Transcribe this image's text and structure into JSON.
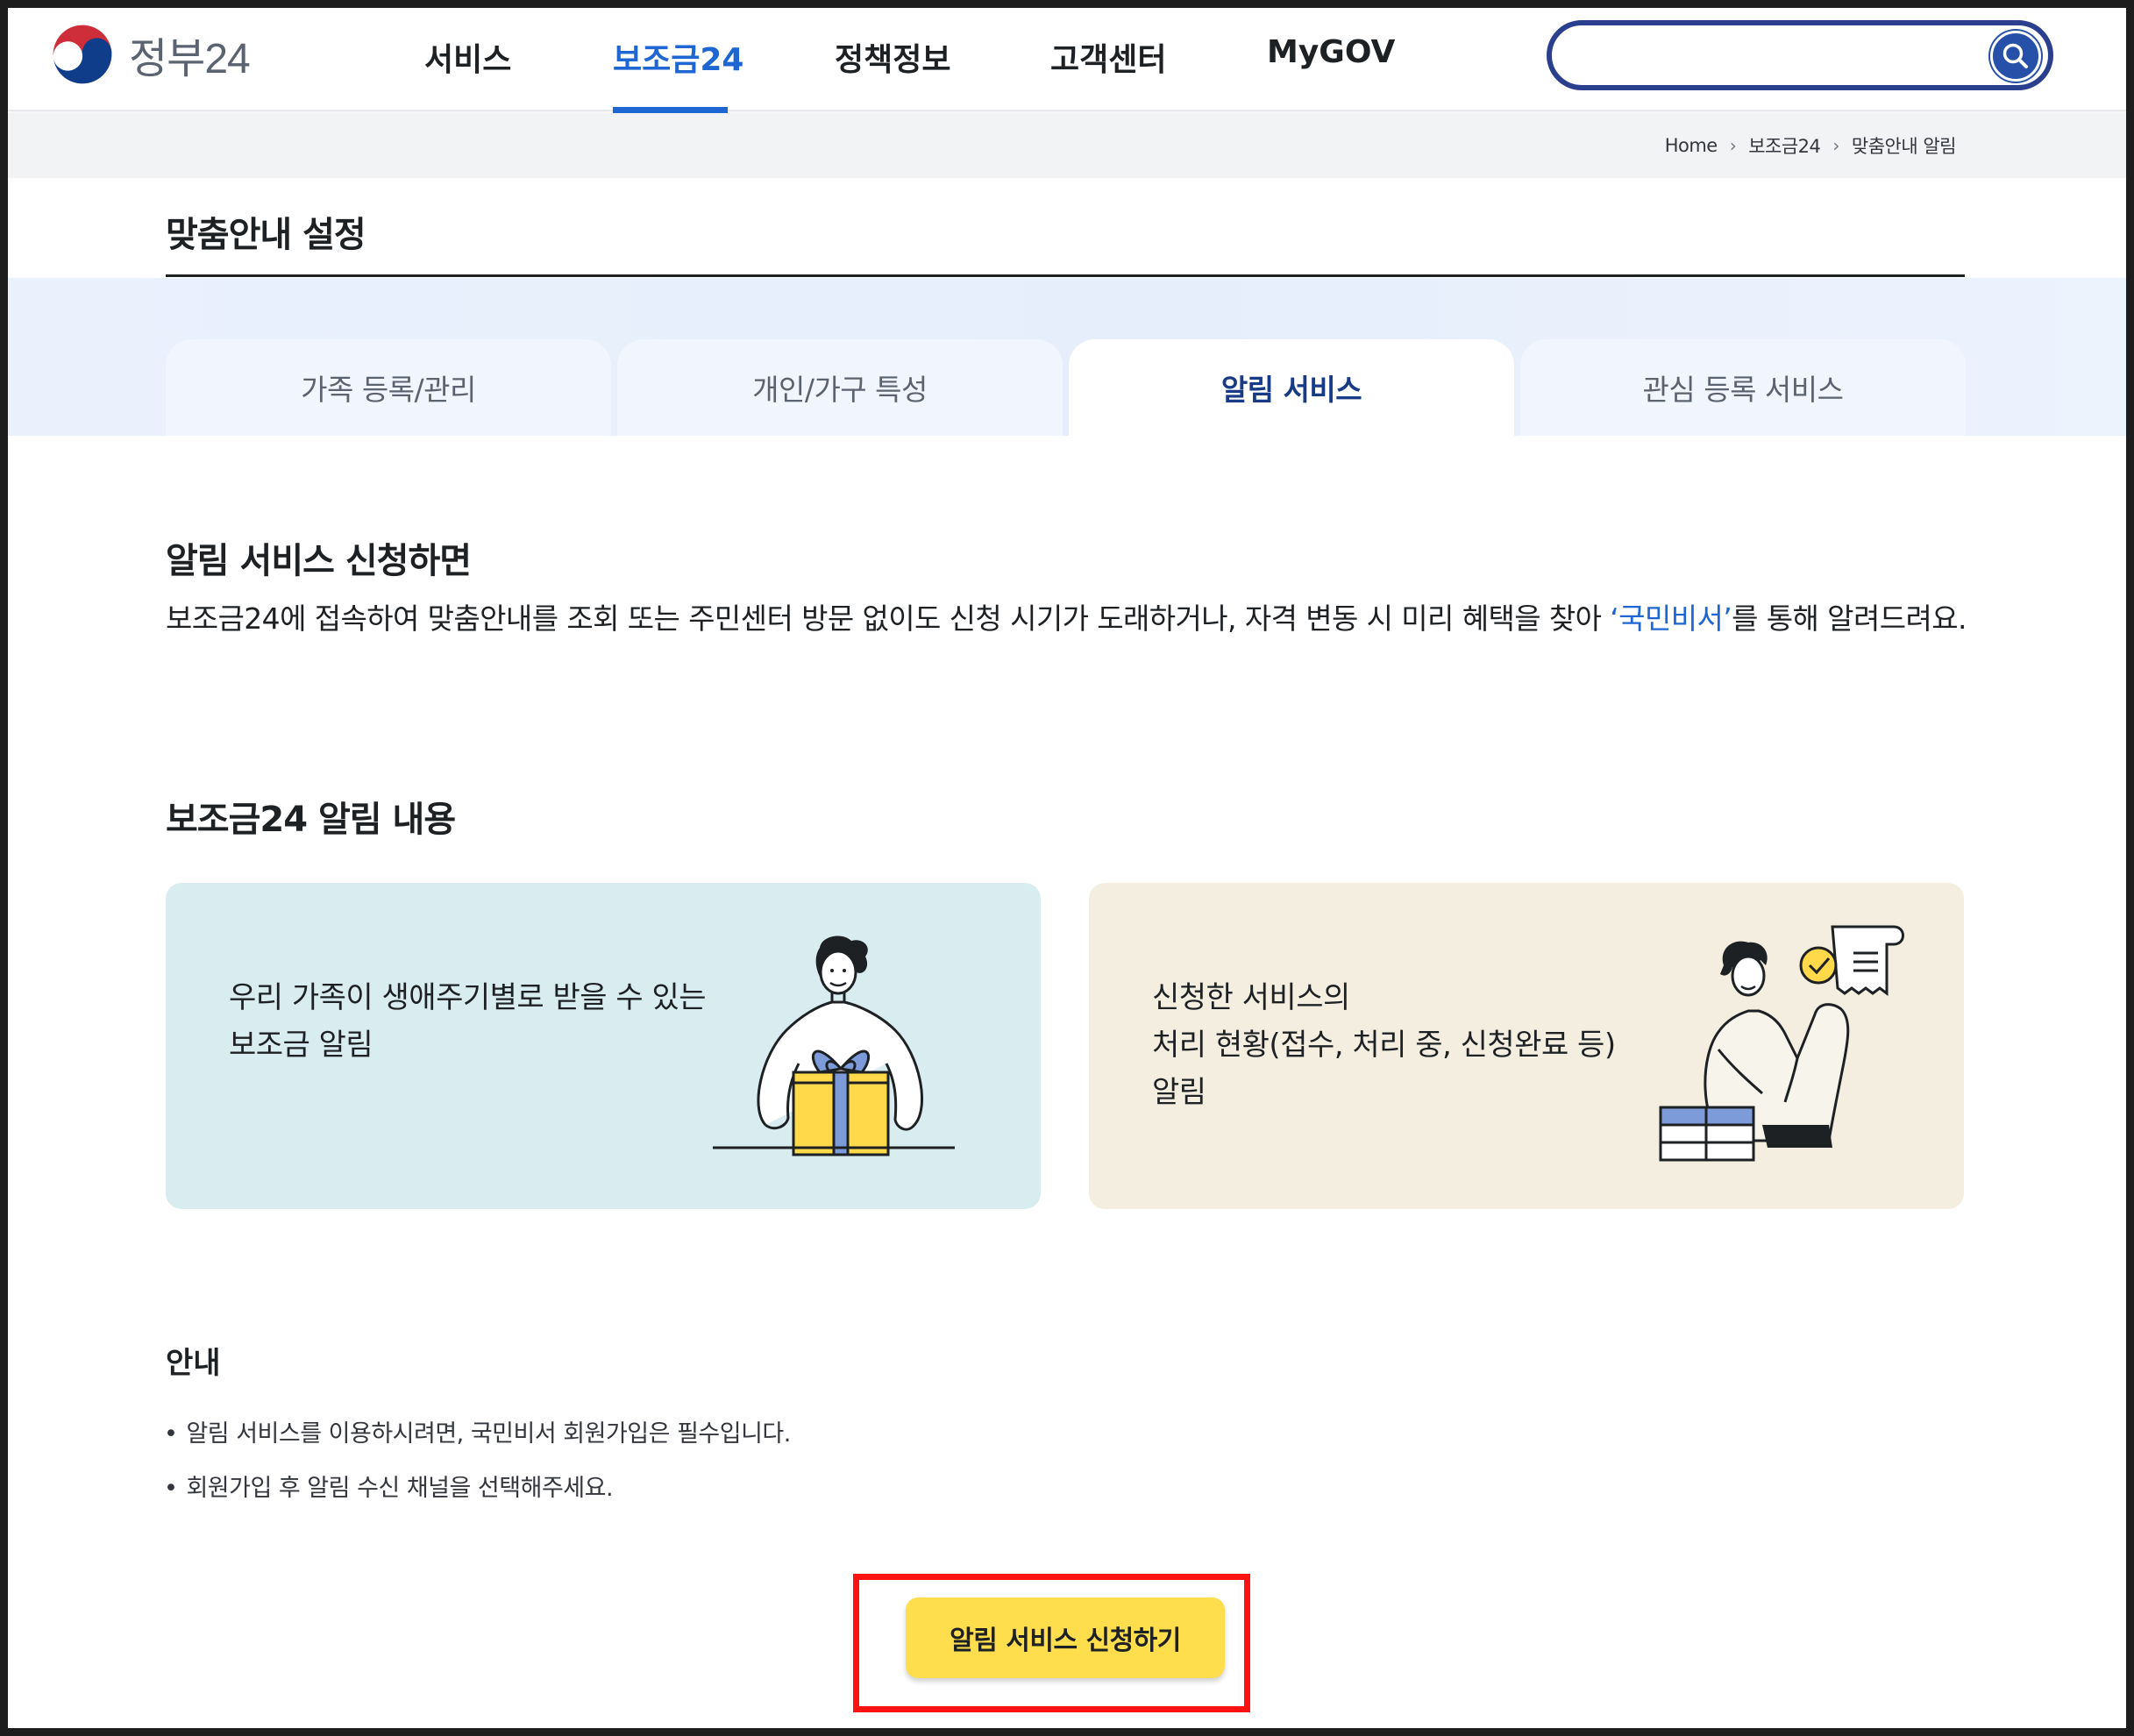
{
  "header": {
    "logo_text": "정부24",
    "nav": [
      {
        "label": "서비스",
        "active": false
      },
      {
        "label": "보조금24",
        "active": true
      },
      {
        "label": "정책정보",
        "active": false
      },
      {
        "label": "고객센터",
        "active": false
      },
      {
        "label": "MyGOV",
        "active": false
      }
    ],
    "search": {
      "placeholder": "",
      "icon": "search-icon"
    }
  },
  "breadcrumb": [
    "Home",
    "보조금24",
    "맞춤안내 알림"
  ],
  "page": {
    "title": "맞춤안내 설정",
    "tabs": [
      {
        "label": "가족 등록/관리",
        "active": false
      },
      {
        "label": "개인/가구 특성",
        "active": false
      },
      {
        "label": "알림 서비스",
        "active": true
      },
      {
        "label": "관심 등록 서비스",
        "active": false
      }
    ]
  },
  "intro": {
    "heading": "알림 서비스 신청하면",
    "text_before": "보조금24에 접속하여 맞춤안내를 조회 또는 주민센터 방문 없이도 신청 시기가 도래하거나, 자격 변동 시 미리 혜택을 찾아 ",
    "highlight": "‘국민비서’",
    "text_after": "를 통해 알려드려요."
  },
  "contents": {
    "heading": "보조금24 알림 내용",
    "cards": [
      {
        "text": "우리 가족이 생애주기별로 받을 수 있는\n보조금 알림",
        "illustration": "gift-illustration"
      },
      {
        "text": "신청한 서비스의\n처리 현황(접수, 처리 중, 신청완료 등)\n알림",
        "illustration": "document-illustration"
      }
    ]
  },
  "notice": {
    "title": "안내",
    "items": [
      "알림 서비스를 이용하시려면, 국민비서 회원가입은 필수입니다.",
      "회원가입 후 알림 수신 채널을 선택해주세요."
    ]
  },
  "cta": {
    "label": "알림 서비스 신청하기"
  },
  "colors": {
    "accent_blue": "#1e66d2",
    "tab_active_text": "#173b86",
    "cta_yellow": "#ffde4d",
    "highlight_red": "#ff1212",
    "card_blue": "#d9edf0",
    "card_beige": "#f3eedf"
  }
}
